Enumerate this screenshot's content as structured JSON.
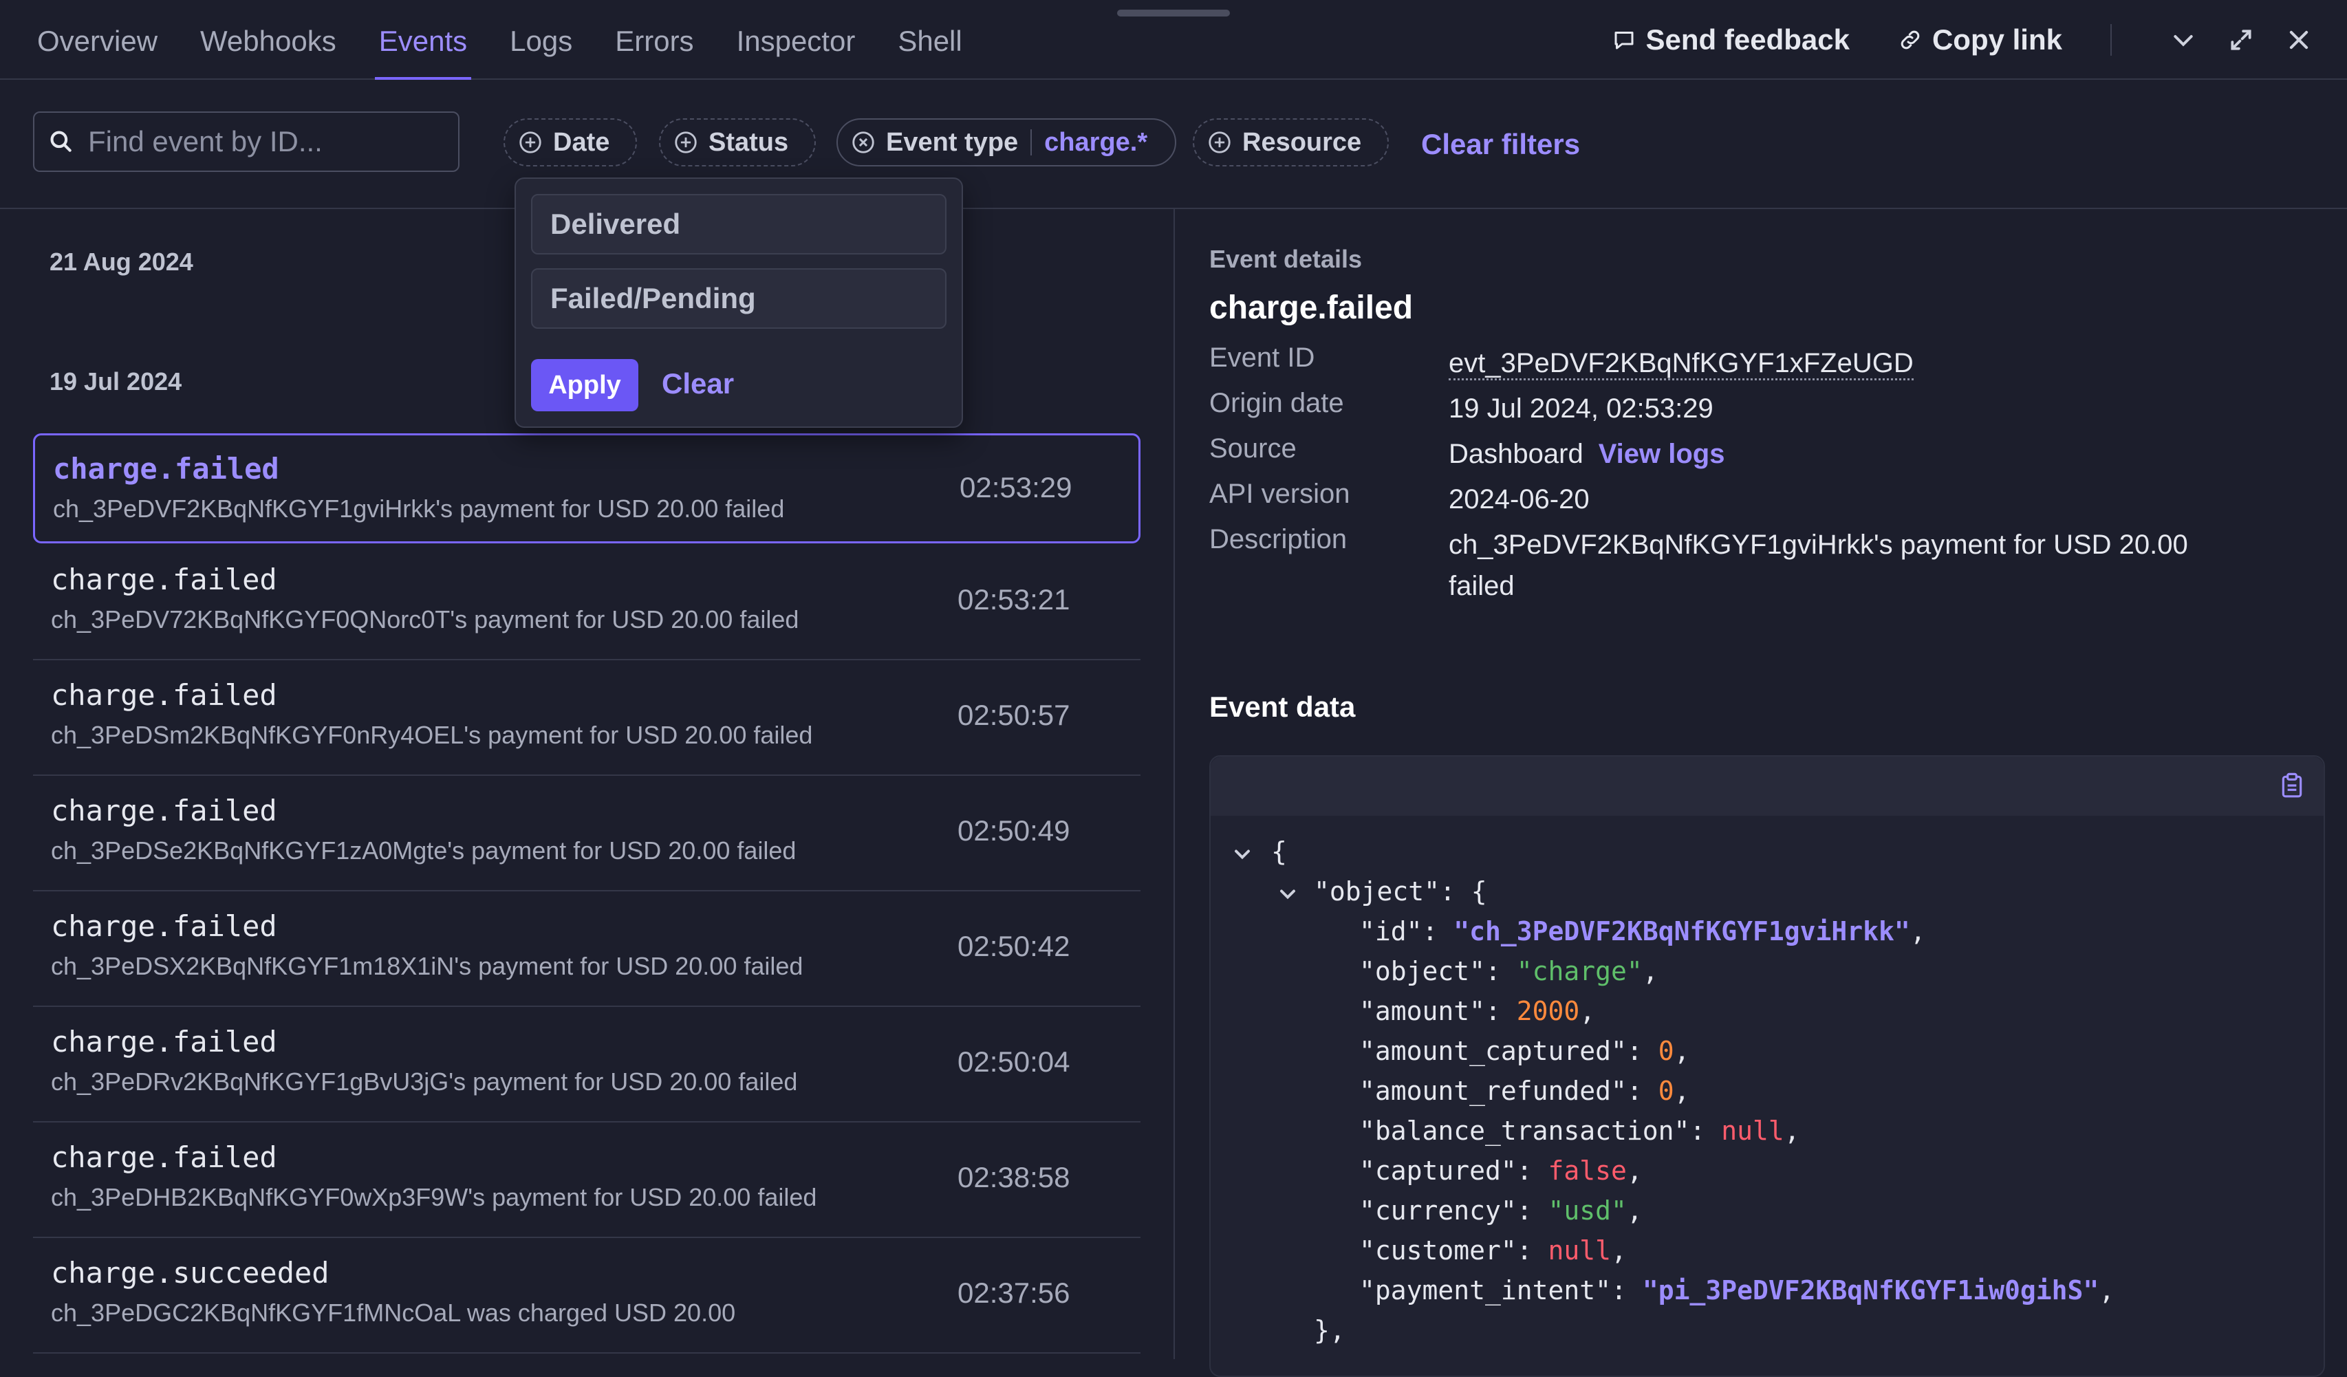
{
  "topbar": {
    "tabs": [
      {
        "label": "Overview"
      },
      {
        "label": "Webhooks"
      },
      {
        "label": "Events",
        "active": true
      },
      {
        "label": "Logs"
      },
      {
        "label": "Errors"
      },
      {
        "label": "Inspector"
      },
      {
        "label": "Shell"
      }
    ],
    "send_feedback": "Send feedback",
    "copy_link": "Copy link"
  },
  "filters": {
    "search_placeholder": "Find event by ID...",
    "date_label": "Date",
    "status_label": "Status",
    "event_type_label": "Event type",
    "event_type_value": "charge.*",
    "resource_label": "Resource",
    "clear_filters": "Clear filters"
  },
  "status_dropdown": {
    "options": [
      "Delivered",
      "Failed/Pending"
    ],
    "apply": "Apply",
    "clear": "Clear"
  },
  "event_list": {
    "groups": [
      {
        "date": "21 Aug 2024"
      },
      {
        "date": "19 Jul 2024"
      }
    ],
    "events": [
      {
        "type": "charge.failed",
        "desc": "ch_3PeDVF2KBqNfKGYF1gviHrkk's payment for USD 20.00 failed",
        "time": "02:53:29",
        "selected": true
      },
      {
        "type": "charge.failed",
        "desc": "ch_3PeDV72KBqNfKGYF0QNorc0T's payment for USD 20.00 failed",
        "time": "02:53:21"
      },
      {
        "type": "charge.failed",
        "desc": "ch_3PeDSm2KBqNfKGYF0nRy4OEL's payment for USD 20.00 failed",
        "time": "02:50:57"
      },
      {
        "type": "charge.failed",
        "desc": "ch_3PeDSe2KBqNfKGYF1zA0Mgte's payment for USD 20.00 failed",
        "time": "02:50:49"
      },
      {
        "type": "charge.failed",
        "desc": "ch_3PeDSX2KBqNfKGYF1m18X1iN's payment for USD 20.00 failed",
        "time": "02:50:42"
      },
      {
        "type": "charge.failed",
        "desc": "ch_3PeDRv2KBqNfKGYF1gBvU3jG's payment for USD 20.00 failed",
        "time": "02:50:04"
      },
      {
        "type": "charge.failed",
        "desc": "ch_3PeDHB2KBqNfKGYF0wXp3F9W's payment for USD 20.00 failed",
        "time": "02:38:58"
      },
      {
        "type": "charge.succeeded",
        "desc": "ch_3PeDGC2KBqNfKGYF1fMNcOaL was charged USD 20.00",
        "time": "02:37:56"
      }
    ]
  },
  "details": {
    "section_label": "Event details",
    "title": "charge.failed",
    "rows": {
      "event_id": {
        "key": "Event ID",
        "value": "evt_3PeDVF2KBqNfKGYF1xFZeUGD"
      },
      "origin_date": {
        "key": "Origin date",
        "value": "19 Jul 2024, 02:53:29"
      },
      "source": {
        "key": "Source",
        "value": "Dashboard",
        "link": "View logs"
      },
      "api_version": {
        "key": "API version",
        "value": "2024-06-20"
      },
      "description": {
        "key": "Description",
        "value": "ch_3PeDVF2KBqNfKGYF1gviHrkk's payment for USD 20.00 failed"
      }
    },
    "event_data_title": "Event data"
  },
  "json_view": {
    "open_brace": "{",
    "object_key": "\"object\": {",
    "lines": [
      {
        "key": "\"id\": ",
        "value": "\"ch_3PeDVF2KBqNfKGYF1gviHrkk\"",
        "kind": "idstr"
      },
      {
        "key": "\"object\": ",
        "value": "\"charge\"",
        "kind": "str"
      },
      {
        "key": "\"amount\": ",
        "value": "2000",
        "kind": "num"
      },
      {
        "key": "\"amount_captured\": ",
        "value": "0",
        "kind": "num"
      },
      {
        "key": "\"amount_refunded\": ",
        "value": "0",
        "kind": "num"
      },
      {
        "key": "\"balance_transaction\": ",
        "value": "null",
        "kind": "null"
      },
      {
        "key": "\"captured\": ",
        "value": "false",
        "kind": "null"
      },
      {
        "key": "\"currency\": ",
        "value": "\"usd\"",
        "kind": "str"
      },
      {
        "key": "\"customer\": ",
        "value": "null",
        "kind": "null"
      },
      {
        "key": "\"payment_intent\": ",
        "value": "\"pi_3PeDVF2KBqNfKGYF1iw0gihS\"",
        "kind": "idstr"
      }
    ],
    "closing": "},"
  },
  "colors": {
    "background": "#1c1e2c",
    "accent": "#9c8dff",
    "button": "#6b57f5",
    "string": "#5fbf6a",
    "number": "#ff8a3d",
    "null": "#ff5c6c"
  }
}
